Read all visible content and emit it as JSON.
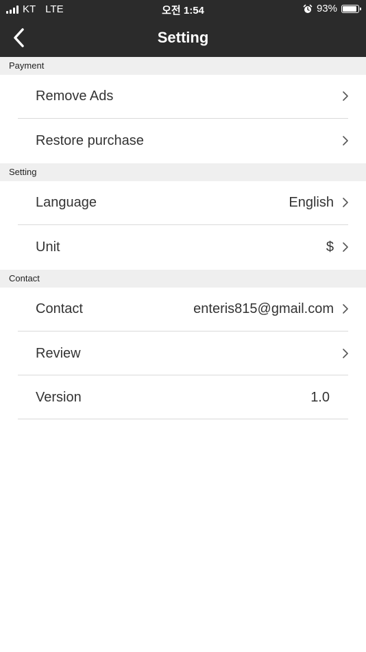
{
  "status_bar": {
    "carrier": "KT",
    "network": "LTE",
    "time": "오전 1:54",
    "battery_percent": "93%",
    "battery_level": 0.93,
    "icons": [
      "signal-icon",
      "alarm-icon",
      "battery-icon"
    ]
  },
  "nav": {
    "title": "Setting",
    "back_icon": "chevron-left-icon"
  },
  "sections": {
    "payment": {
      "header": "Payment",
      "remove_ads": {
        "label": "Remove Ads"
      },
      "restore_purchase": {
        "label": "Restore purchase"
      }
    },
    "setting": {
      "header": "Setting",
      "language": {
        "label": "Language",
        "value": "English"
      },
      "unit": {
        "label": "Unit",
        "value": "$"
      }
    },
    "contact": {
      "header": "Contact",
      "contact": {
        "label": "Contact",
        "value": "enteris815@gmail.com"
      },
      "review": {
        "label": "Review"
      },
      "version": {
        "label": "Version",
        "value": "1.0"
      }
    }
  },
  "colors": {
    "header_bg": "#2b2b2b",
    "section_bg": "#efefef",
    "text": "#333333",
    "divider": "#d9d9d9",
    "chevron": "#555555"
  }
}
